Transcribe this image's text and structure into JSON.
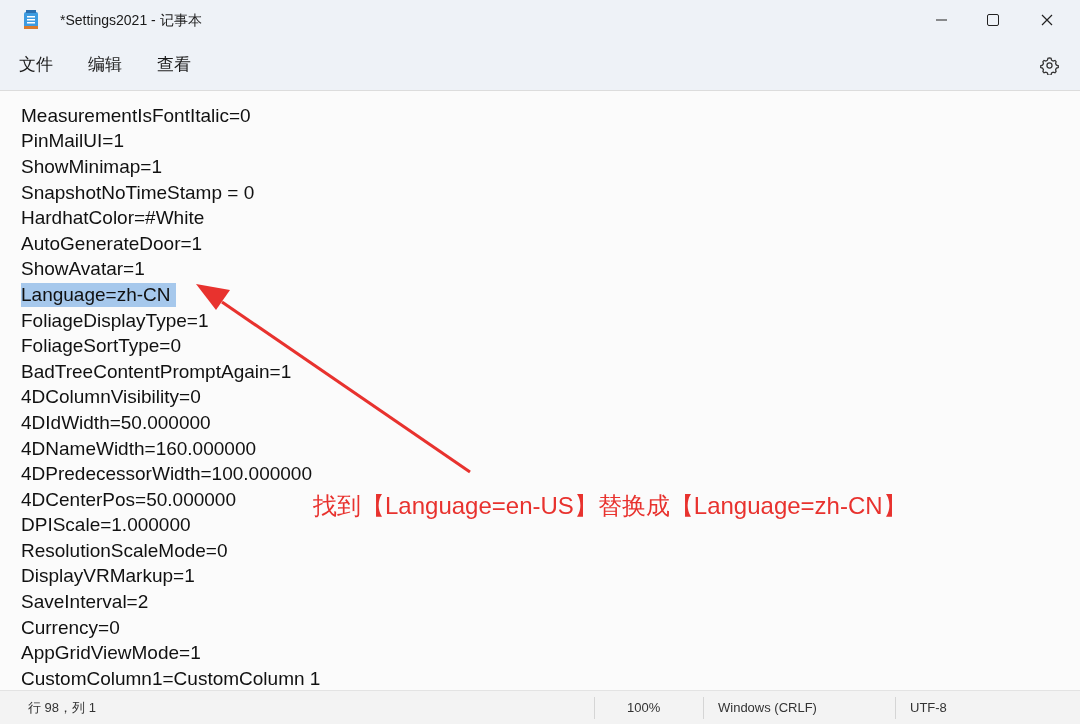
{
  "window": {
    "title": "*Settings2021 - 记事本"
  },
  "menu": [
    "文件",
    "编辑",
    "查看"
  ],
  "lines": [
    {
      "text": "MeasurementIsFontItalic=0",
      "selected": false
    },
    {
      "text": "PinMailUI=1",
      "selected": false
    },
    {
      "text": "ShowMinimap=1",
      "selected": false
    },
    {
      "text": "SnapshotNoTimeStamp = 0",
      "selected": false
    },
    {
      "text": "HardhatColor=#White",
      "selected": false
    },
    {
      "text": "AutoGenerateDoor=1",
      "selected": false
    },
    {
      "text": "ShowAvatar=1",
      "selected": false
    },
    {
      "text": "Language=zh-CN ",
      "selected": true
    },
    {
      "text": "FoliageDisplayType=1",
      "selected": false
    },
    {
      "text": "FoliageSortType=0",
      "selected": false
    },
    {
      "text": "BadTreeContentPromptAgain=1",
      "selected": false
    },
    {
      "text": "4DColumnVisibility=0",
      "selected": false
    },
    {
      "text": "4DIdWidth=50.000000",
      "selected": false
    },
    {
      "text": "4DNameWidth=160.000000",
      "selected": false
    },
    {
      "text": "4DPredecessorWidth=100.000000",
      "selected": false
    },
    {
      "text": "4DCenterPos=50.000000",
      "selected": false
    },
    {
      "text": "DPIScale=1.000000",
      "selected": false
    },
    {
      "text": "ResolutionScaleMode=0",
      "selected": false
    },
    {
      "text": "DisplayVRMarkup=1",
      "selected": false
    },
    {
      "text": "SaveInterval=2",
      "selected": false
    },
    {
      "text": "Currency=0",
      "selected": false
    },
    {
      "text": "AppGridViewMode=1",
      "selected": false
    },
    {
      "text": "CustomColumn1=CustomColumn 1",
      "selected": false
    }
  ],
  "annotation": {
    "text": "找到【Language=en-US】替换成【Language=zh-CN】"
  },
  "status_bar": {
    "position": "行 98，列 1",
    "zoom": "100%",
    "line_ending": "Windows (CRLF)",
    "encoding": "UTF-8"
  }
}
